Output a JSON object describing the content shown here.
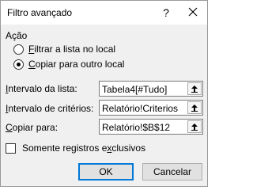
{
  "window": {
    "title": "Filtro avançado",
    "help_label": "?"
  },
  "action": {
    "group_label": "Ação",
    "options": [
      {
        "accel": "F",
        "rest": "iltrar a lista no local",
        "checked": false
      },
      {
        "accel": "C",
        "rest": "opiar para outro local",
        "checked": true
      }
    ]
  },
  "fields": {
    "list_range": {
      "accel": "I",
      "rest": "ntervalo da lista:",
      "value": "Tabela4[#Tudo]"
    },
    "criteria_range": {
      "accel": "I",
      "rest": "ntervalo de critérios:",
      "value": "Relatório!Criterios"
    },
    "copy_to": {
      "accel": "C",
      "rest": "opiar para:",
      "value": "Relatório!$B$12"
    }
  },
  "unique_records": {
    "label_before": "Somente registros e",
    "accel": "x",
    "label_after": "clusivos",
    "checked": false
  },
  "buttons": {
    "ok_label": "OK",
    "cancel_label": "Cancelar"
  }
}
